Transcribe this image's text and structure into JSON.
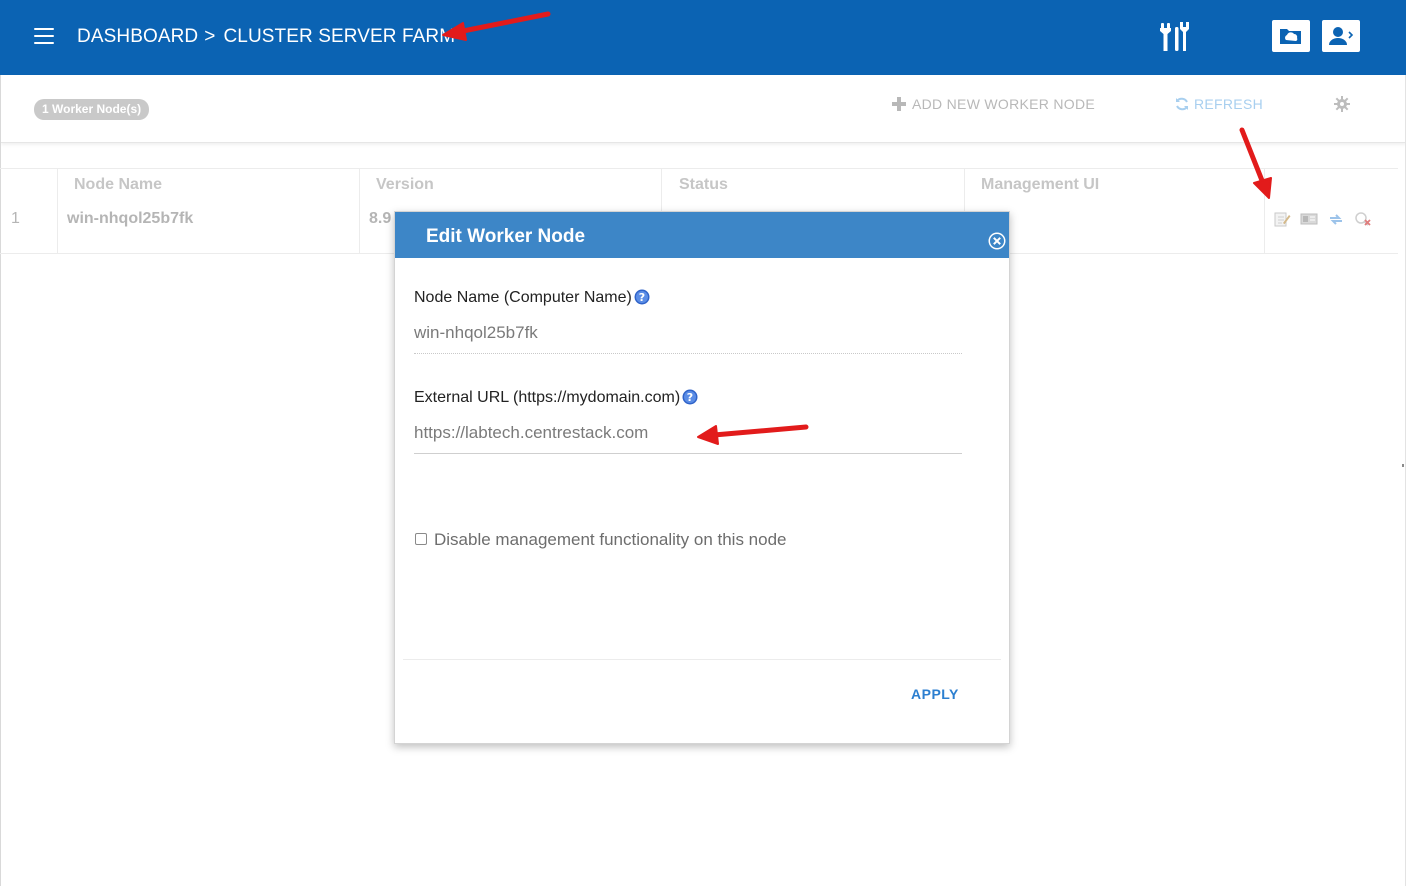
{
  "header": {
    "breadcrumb": [
      "DASHBOARD",
      "CLUSTER SERVER FARM"
    ],
    "separator": ">",
    "bg_color": "#0b63b3"
  },
  "toolbar": {
    "node_count_badge": "1 Worker Node(s)",
    "add_label": "ADD NEW WORKER NODE",
    "refresh_label": "REFRESH"
  },
  "table": {
    "columns": [
      "Node Name",
      "Version",
      "Status",
      "Management UI"
    ],
    "rows": [
      {
        "index": "1",
        "node_name": "win-nhqol25b7fk",
        "version": "8.9"
      }
    ]
  },
  "modal": {
    "title": "Edit Worker Node",
    "node_name_label": "Node Name (Computer Name)",
    "node_name_value": "win-nhqol25b7fk",
    "external_url_label": "External URL (https://mydomain.com)",
    "external_url_value": "https://labtech.centrestack.com",
    "disable_mgmt_label": "Disable management functionality on this node",
    "disable_mgmt_checked": false,
    "apply_label": "APPLY",
    "header_color": "#3d86c7"
  },
  "icons": {
    "header": [
      "menu-icon",
      "tools-icon",
      "cloud-folder-icon",
      "user-icon"
    ],
    "toolbar": [
      "plus-icon",
      "refresh-icon",
      "gear-icon"
    ],
    "row_actions": [
      "edit-icon",
      "license-icon",
      "sync-icon",
      "delete-icon"
    ],
    "modal": [
      "close-icon",
      "help-icon"
    ]
  },
  "annotation_color": "#e21b1b"
}
